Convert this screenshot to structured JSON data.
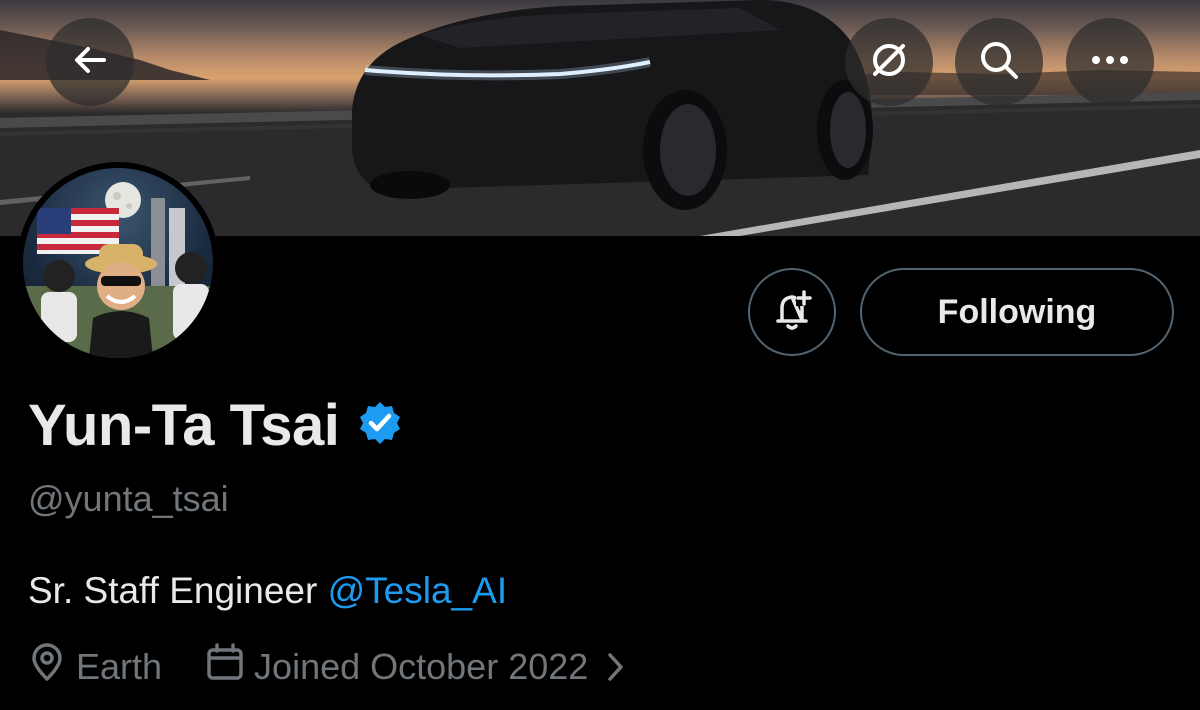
{
  "profile": {
    "display_name": "Yun-Ta Tsai",
    "verified": true,
    "handle": "@yunta_tsai",
    "bio_text": "Sr. Staff Engineer ",
    "bio_mention": "@Tesla_AI",
    "location": "Earth",
    "joined": "Joined October 2022"
  },
  "actions": {
    "follow_label": "Following"
  },
  "icons": {
    "back": "back-arrow-icon",
    "grok": "grok-icon",
    "search": "search-icon",
    "more": "more-icon",
    "notify": "bell-plus-icon",
    "verified": "verified-badge-icon",
    "location": "location-pin-icon",
    "calendar": "calendar-icon",
    "chevron": "chevron-right-icon"
  },
  "colors": {
    "accent": "#1d9bf0",
    "muted_text": "#71767b",
    "primary_text": "#e7e9ea",
    "border": "#536471",
    "background": "#000000"
  }
}
